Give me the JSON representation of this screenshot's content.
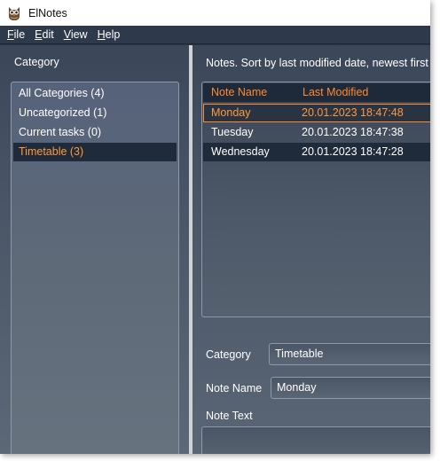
{
  "window": {
    "title": "ElNotes",
    "icon": "owl-icon"
  },
  "menu": {
    "items": [
      {
        "accel": "F",
        "rest": "ile"
      },
      {
        "accel": "E",
        "rest": "dit"
      },
      {
        "accel": "V",
        "rest": "iew"
      },
      {
        "accel": "H",
        "rest": "elp"
      }
    ]
  },
  "categories": {
    "title": "Category",
    "items": [
      {
        "label": "All Categories (4)",
        "selected": false
      },
      {
        "label": "Uncategorized (1)",
        "selected": false
      },
      {
        "label": "Current tasks (0)",
        "selected": false
      },
      {
        "label": "Timetable (3)",
        "selected": true
      }
    ]
  },
  "notes": {
    "title": "Notes. Sort by last modified date, newest first",
    "columns": [
      "Note Name",
      "Last Modified"
    ],
    "rows": [
      {
        "name": "Monday",
        "modified": "20.01.2023 18:47:48",
        "state": "selected"
      },
      {
        "name": "Tuesday",
        "modified": "20.01.2023 18:47:38",
        "state": "normal"
      },
      {
        "name": "Wednesday",
        "modified": "20.01.2023 18:47:28",
        "state": "highlighted"
      }
    ]
  },
  "editor": {
    "category_label": "Category",
    "category_value": "Timetable",
    "name_label": "Note Name",
    "name_value": "Monday",
    "text_label": "Note Text"
  },
  "colors": {
    "accent": "#ff8a30",
    "pane_bg": "#3b4759",
    "selection_bg": "#1f2a3b"
  }
}
